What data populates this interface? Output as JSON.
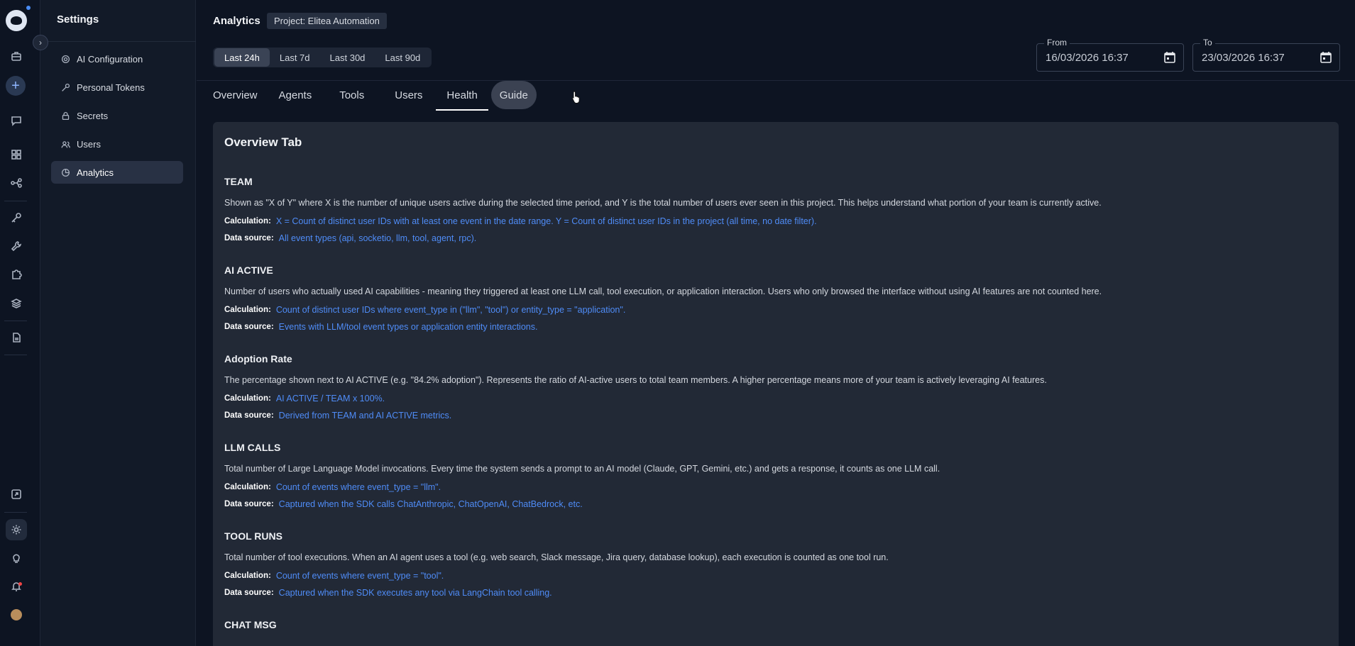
{
  "rail": {
    "icons": [
      "briefcase-icon",
      "chat-icon",
      "apps-icon",
      "flow-icon",
      "key-icon",
      "wrench-icon",
      "puzzle-icon",
      "stack-icon",
      "document-icon",
      "export-icon",
      "settings-icon",
      "bulb-icon",
      "bell-icon"
    ]
  },
  "sidebar": {
    "title": "Settings",
    "items": [
      {
        "label": "AI Configuration",
        "icon": "gear-icon"
      },
      {
        "label": "Personal Tokens",
        "icon": "key-icon"
      },
      {
        "label": "Secrets",
        "icon": "lock-icon"
      },
      {
        "label": "Users",
        "icon": "users-icon"
      },
      {
        "label": "Analytics",
        "icon": "analytics-icon",
        "active": true
      }
    ]
  },
  "header": {
    "title": "Analytics",
    "project": "Project: Elitea Automation",
    "ranges": [
      "Last 24h",
      "Last 7d",
      "Last 30d",
      "Last 90d"
    ],
    "active_range": "Last 24h",
    "from_label": "From",
    "from_value": "16/03/2026 16:37",
    "to_label": "To",
    "to_value": "23/03/2026 16:37"
  },
  "tabs": [
    "Overview",
    "Agents",
    "Tools",
    "Users",
    "Health",
    "Guide"
  ],
  "active_tab": "Health",
  "guide": {
    "heading": "Overview Tab",
    "calc_label": "Calculation:",
    "source_label": "Data source:",
    "metrics": [
      {
        "title": "TEAM",
        "description": "Shown as \"X of Y\" where X is the number of unique users active during the selected time period, and Y is the total number of users ever seen in this project. This helps understand what portion of your team is currently active.",
        "calculation": "X = Count of distinct user IDs with at least one event in the date range. Y = Count of distinct user IDs in the project (all time, no date filter).",
        "source": "All event types (api, socketio, llm, tool, agent, rpc)."
      },
      {
        "title": "AI ACTIVE",
        "description": "Number of users who actually used AI capabilities - meaning they triggered at least one LLM call, tool execution, or application interaction. Users who only browsed the interface without using AI features are not counted here.",
        "calculation": "Count of distinct user IDs where event_type in (\"llm\", \"tool\") or entity_type = \"application\".",
        "source": "Events with LLM/tool event types or application entity interactions."
      },
      {
        "title": "Adoption Rate",
        "description": "The percentage shown next to AI ACTIVE (e.g. \"84.2% adoption\"). Represents the ratio of AI-active users to total team members. A higher percentage means more of your team is actively leveraging AI features.",
        "calculation": "AI ACTIVE / TEAM x 100%.",
        "source": "Derived from TEAM and AI ACTIVE metrics."
      },
      {
        "title": "LLM CALLS",
        "description": "Total number of Large Language Model invocations. Every time the system sends a prompt to an AI model (Claude, GPT, Gemini, etc.) and gets a response, it counts as one LLM call.",
        "calculation": "Count of events where event_type = \"llm\".",
        "source": "Captured when the SDK calls ChatAnthropic, ChatOpenAI, ChatBedrock, etc."
      },
      {
        "title": "TOOL RUNS",
        "description": "Total number of tool executions. When an AI agent uses a tool (e.g. web search, Slack message, Jira query, database lookup), each execution is counted as one tool run.",
        "calculation": "Count of events where event_type = \"tool\".",
        "source": "Captured when the SDK executes any tool via LangChain tool calling."
      },
      {
        "title": "CHAT MSG",
        "description": "",
        "calculation": "",
        "source": ""
      }
    ]
  }
}
